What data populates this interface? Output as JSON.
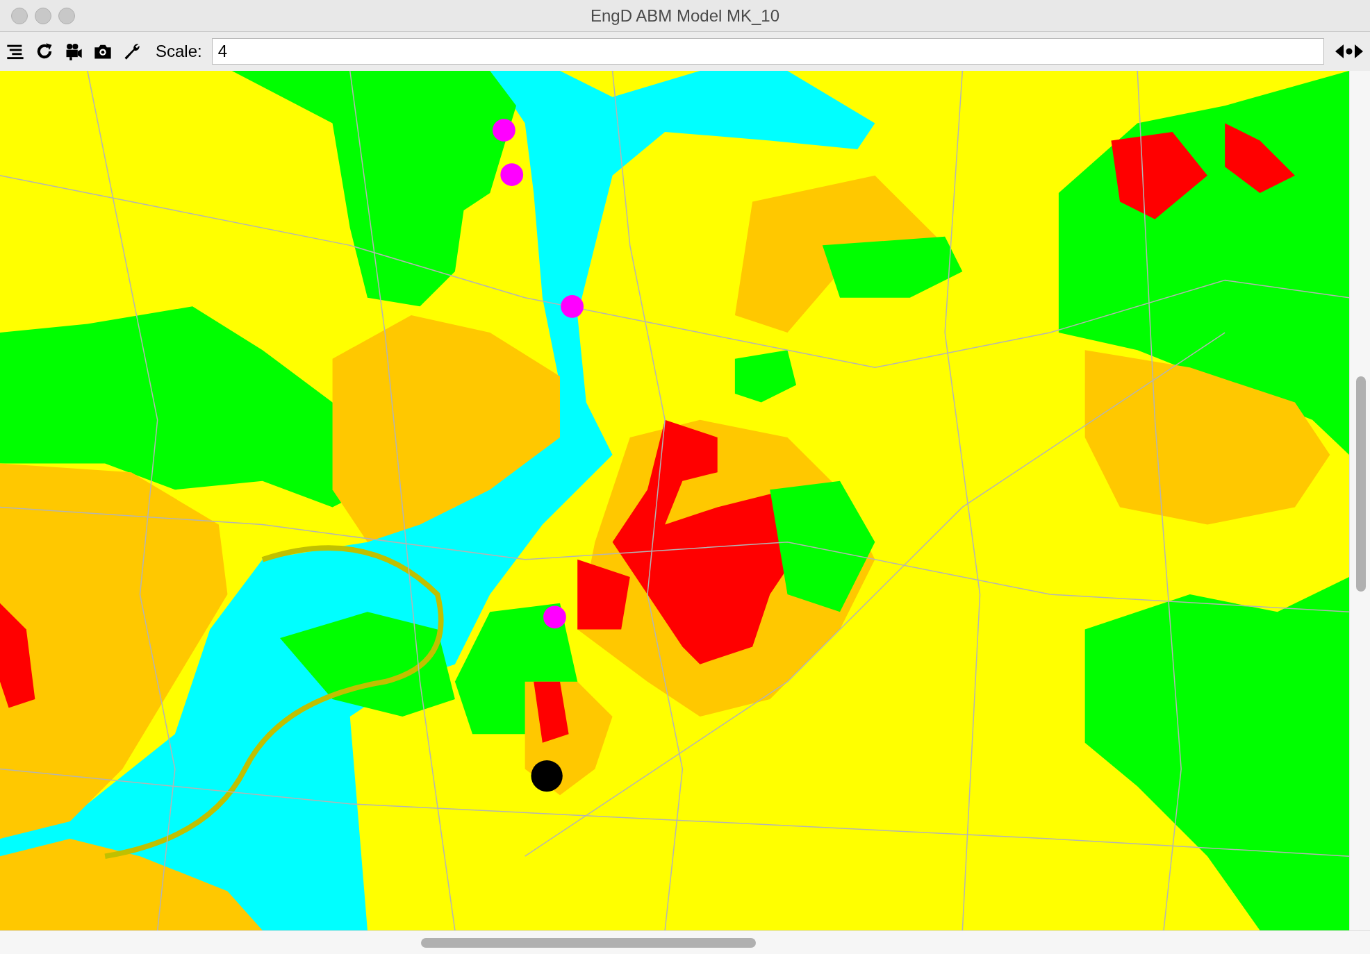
{
  "window": {
    "title": "EngD ABM Model MK_10"
  },
  "toolbar": {
    "scale_label": "Scale:",
    "scale_value": "4"
  }
}
